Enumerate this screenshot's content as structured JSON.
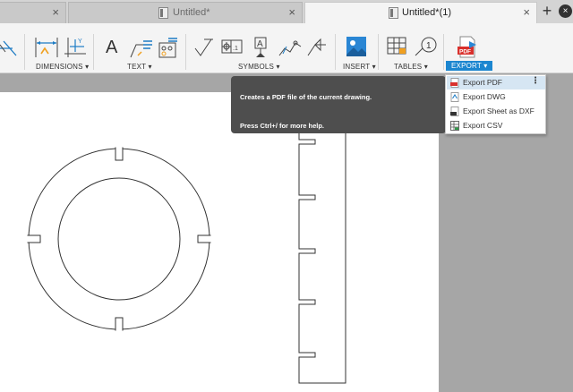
{
  "tabs": [
    {
      "label": "",
      "close": "×"
    },
    {
      "label": "Untitled*",
      "close": "×"
    },
    {
      "label": "Untitled*(1)",
      "close": "×"
    }
  ],
  "tab_add": "+",
  "window_close": "×",
  "ribbon": {
    "groups": [
      "DIMENSIONS ▾",
      "TEXT ▾",
      "SYMBOLS ▾",
      "INSERT ▾",
      "TABLES ▾",
      "EXPORT ▾"
    ],
    "text_glyph": "A",
    "balloon_number": "1",
    "pdf_badge": "PDF"
  },
  "tooltip": {
    "line1": "Creates a PDF file of the current drawing.",
    "line2": "Press Ctrl+/ for more help."
  },
  "export_menu": {
    "items": [
      "Export PDF",
      "Export DWG",
      "Export Sheet as DXF",
      "Export CSV"
    ],
    "more": "⋮"
  },
  "colors": {
    "accent": "#1c86d0",
    "tooltip_bg": "#4e4e4e",
    "menu_hover": "#d6e6f3",
    "workspace": "#a6a6a6"
  }
}
